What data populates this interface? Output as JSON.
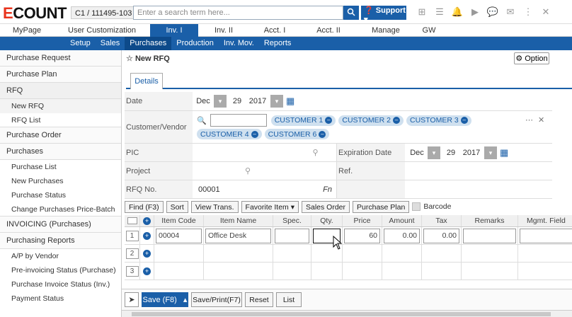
{
  "app": {
    "logo_e": "E",
    "logo_rest": "COUNT",
    "company": "C1 / 111495-103"
  },
  "search": {
    "placeholder": "Enter a search term here...",
    "support_label": "Support ▾"
  },
  "menu1": [
    "MyPage",
    "User Customization",
    "Inv. I",
    "Inv. II",
    "Acct. I",
    "Acct. II",
    "Manage",
    "GW"
  ],
  "menu2": [
    "Setup",
    "Sales",
    "Purchases",
    "Production",
    "Inv. Mov.",
    "Reports"
  ],
  "sidebar": {
    "groups": [
      {
        "label": "Purchase Request"
      },
      {
        "label": "Purchase Plan"
      },
      {
        "label": "RFQ",
        "subs": [
          "New RFQ",
          "RFQ List"
        ]
      },
      {
        "label": "Purchase Order"
      },
      {
        "label": "Purchases",
        "subs": [
          "Purchase List",
          "New Purchases",
          "Purchase Status",
          "Change Purchases Price-Batch"
        ]
      },
      {
        "label": "INVOICING (Purchases)"
      },
      {
        "label": "Purchasing Reports",
        "subs": [
          "A/P by Vendor",
          "Pre-invoicing Status (Purchase)",
          "Purchase Invoice Status (Inv.)",
          "Payment Status"
        ]
      }
    ]
  },
  "page": {
    "title": "New RFQ",
    "option_label": "Option",
    "tab_details": "Details"
  },
  "form": {
    "date_label": "Date",
    "date_month": "Dec",
    "date_day": "29",
    "date_year": "2017",
    "customer_label": "Customer/Vendor",
    "customers": [
      "CUSTOMER 1",
      "CUSTOMER 2",
      "CUSTOMER 3",
      "CUSTOMER 4",
      "CUSTOMER 6"
    ],
    "pic_label": "PIC",
    "exp_label": "Expiration Date",
    "exp_month": "Dec",
    "exp_day": "29",
    "exp_year": "2017",
    "project_label": "Project",
    "ref_label": "Ref.",
    "rfq_no_label": "RFQ No.",
    "rfq_no": "00001",
    "fn": "Fn"
  },
  "toolbar": [
    "Find (F3)",
    "Sort",
    "View Trans.",
    "Favorite Item ▾",
    "Sales Order",
    "Purchase Plan"
  ],
  "barcode_label": "Barcode",
  "grid": {
    "headers": [
      "Item Code",
      "Item Name",
      "Spec.",
      "Qty.",
      "Price",
      "Amount",
      "Tax",
      "Remarks",
      "Mgmt. Field"
    ],
    "rows": [
      {
        "num": "1",
        "code": "00004",
        "name": "Office Desk",
        "spec": "",
        "qty": "",
        "price": "60",
        "amount": "0.00",
        "tax": "0.00",
        "remarks": "",
        "mgmt": ""
      },
      {
        "num": "2"
      },
      {
        "num": "3"
      }
    ]
  },
  "bottom": {
    "save": "Save (F8)",
    "save_print": "Save/Print(F7)",
    "reset": "Reset",
    "list": "List"
  }
}
